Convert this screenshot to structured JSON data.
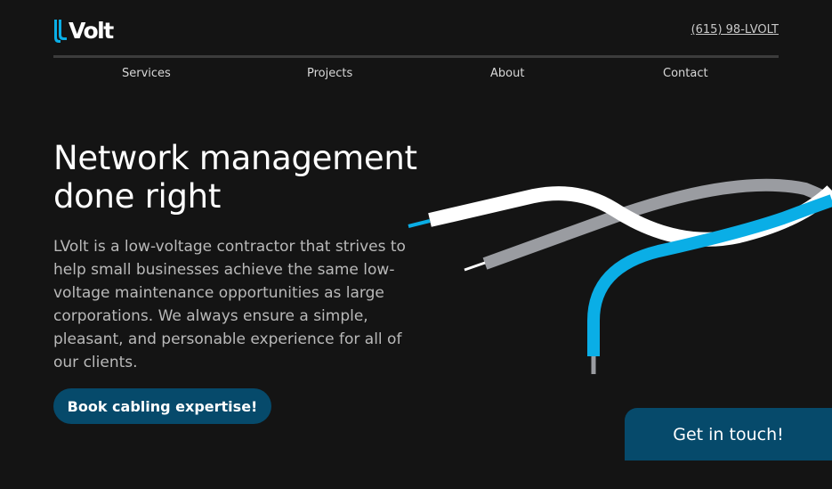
{
  "brand": {
    "logo_text": "Volt",
    "accent_color": "#0aaee6"
  },
  "header": {
    "phone": "(615) 98-LVOLT"
  },
  "nav": {
    "items": [
      {
        "label": "Services"
      },
      {
        "label": "Projects"
      },
      {
        "label": "About"
      },
      {
        "label": "Contact"
      }
    ]
  },
  "hero": {
    "title": "Network management done right",
    "description": "LVolt is a low-voltage contractor that strives to help small businesses achieve the same low-voltage maintenance opportunities as large corporations. We always ensure a simple, pleasant, and personable experience for all of our clients.",
    "cta_label": "Book cabling expertise!"
  },
  "contact_cta": {
    "label": "Get in touch!"
  },
  "colors": {
    "background": "#141414",
    "button": "#064a6b",
    "cable_blue": "#0aaee6",
    "cable_gray": "#9a9ca1",
    "cable_white": "#ffffff"
  },
  "illustration": {
    "icon": "network-cables-illustration"
  }
}
